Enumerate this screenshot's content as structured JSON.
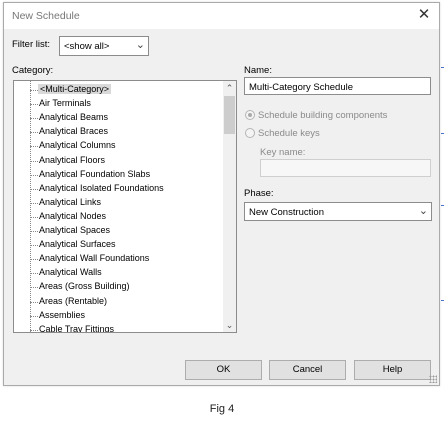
{
  "dialog": {
    "title": "New Schedule",
    "close_symbol": "✕"
  },
  "filter": {
    "label": "Filter list:",
    "value": "<show all>"
  },
  "category": {
    "label": "Category:",
    "items": [
      "<Multi-Category>",
      "Air Terminals",
      "Analytical Beams",
      "Analytical Braces",
      "Analytical Columns",
      "Analytical Floors",
      "Analytical Foundation Slabs",
      "Analytical Isolated Foundations",
      "Analytical Links",
      "Analytical Nodes",
      "Analytical Spaces",
      "Analytical Surfaces",
      "Analytical Wall Foundations",
      "Analytical Walls",
      "Areas (Gross Building)",
      "Areas (Rentable)",
      "Assemblies",
      "Cable Tray Fittings"
    ],
    "selected_index": 0
  },
  "name": {
    "label": "Name:",
    "value": "Multi-Category Schedule"
  },
  "schedule_options": {
    "building_components": "Schedule building components",
    "keys": "Schedule keys",
    "key_name_label": "Key name:",
    "key_name_value": ""
  },
  "phase": {
    "label": "Phase:",
    "value": "New Construction"
  },
  "buttons": {
    "ok": "OK",
    "cancel": "Cancel",
    "help": "Help"
  },
  "caption": "Fig 4"
}
